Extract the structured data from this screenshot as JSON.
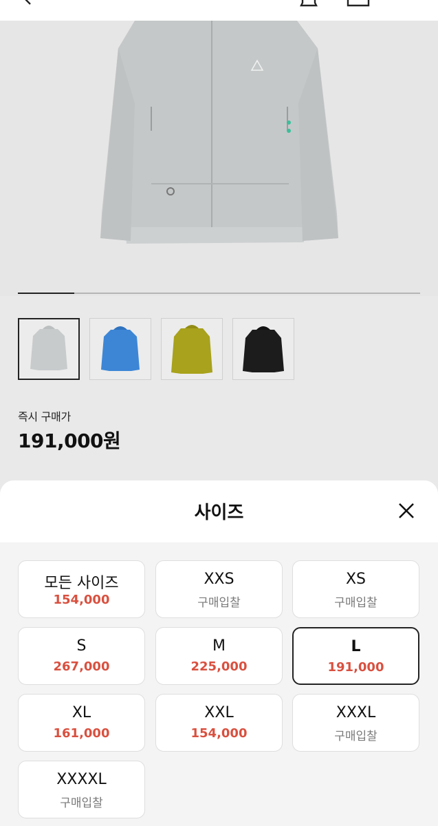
{
  "product": {
    "thumbnails": [
      {
        "name": "gray-jacket",
        "color": "#c8cbcc"
      },
      {
        "name": "blue-jacket",
        "color": "#3d86d6"
      },
      {
        "name": "olive-jacket",
        "color": "#a8a21c"
      },
      {
        "name": "black-jacket",
        "color": "#1c1c1c"
      }
    ],
    "gallery_progress": 0.14
  },
  "price": {
    "label": "즉시 구매가",
    "value": "191,000원"
  },
  "sheet": {
    "title": "사이즈",
    "sizes": [
      {
        "name": "모든 사이즈",
        "price": "154,000",
        "type": "price"
      },
      {
        "name": "XXS",
        "price": "구매입찰",
        "type": "bid"
      },
      {
        "name": "XS",
        "price": "구매입찰",
        "type": "bid"
      },
      {
        "name": "S",
        "price": "267,000",
        "type": "price"
      },
      {
        "name": "M",
        "price": "225,000",
        "type": "price"
      },
      {
        "name": "L",
        "price": "191,000",
        "type": "price",
        "selected": true
      },
      {
        "name": "XL",
        "price": "161,000",
        "type": "price"
      },
      {
        "name": "XXL",
        "price": "154,000",
        "type": "price"
      },
      {
        "name": "XXXL",
        "price": "구매입찰",
        "type": "bid"
      },
      {
        "name": "XXXXL",
        "price": "구매입찰",
        "type": "bid"
      }
    ]
  },
  "colors": {
    "price_accent": "#d9503f",
    "bid_text": "#7a7a7a"
  }
}
